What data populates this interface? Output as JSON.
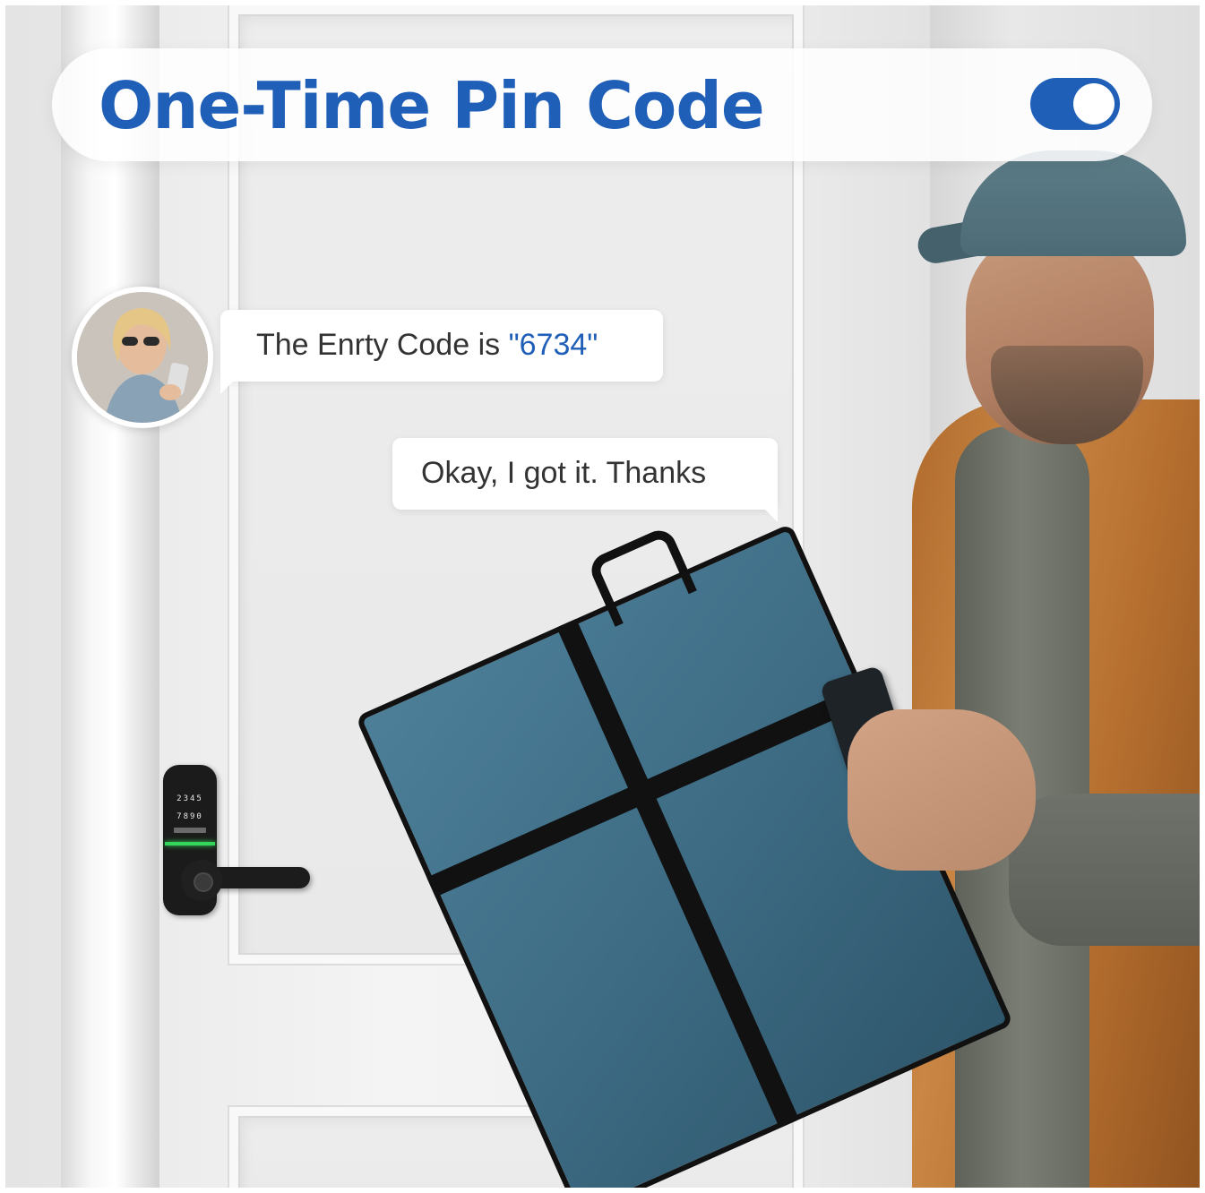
{
  "header": {
    "title": "One-Time Pin Code",
    "toggle_on": true,
    "accent_color": "#1f5fb8"
  },
  "chat": {
    "message_1_prefix": "The Enrty Code is ",
    "message_1_code": "\"6734\"",
    "message_2": "Okay, I got it. Thanks"
  },
  "lock": {
    "keypad_row_1": "2345",
    "keypad_row_2": "7890",
    "led_color": "#33d65a"
  },
  "icons": {
    "toggle": "toggle-switch-icon",
    "avatar": "user-avatar"
  }
}
